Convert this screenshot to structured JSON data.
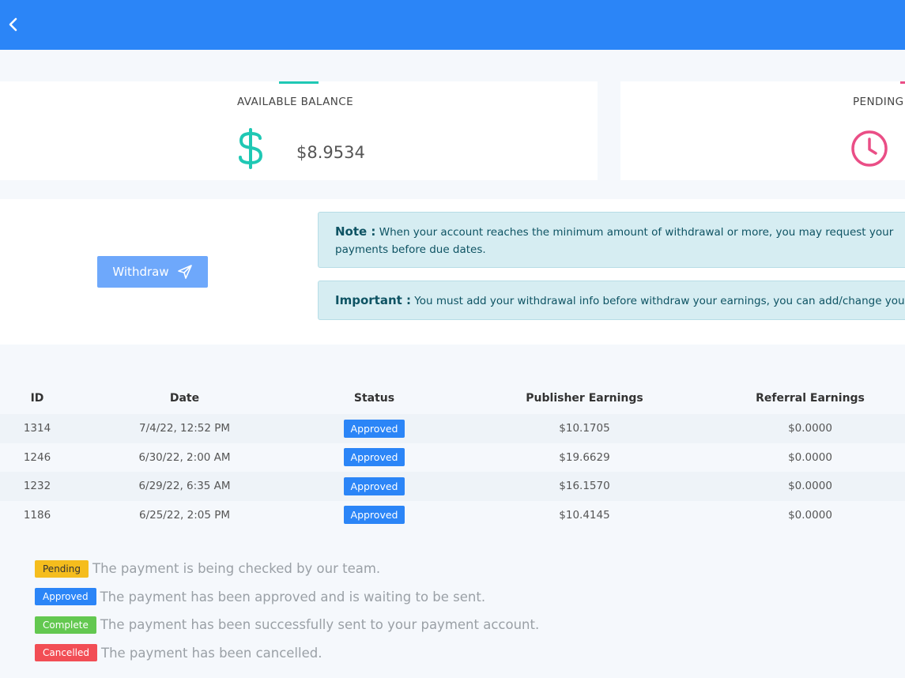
{
  "header": {
    "back_icon": "chevron-left-icon",
    "color": "#2b85f7"
  },
  "cards": {
    "available": {
      "title": "AVAILABLE BALANCE",
      "value": "$8.9534",
      "icon": "dollar-icon",
      "accent": "#1fc8b4"
    },
    "pending": {
      "title": "PENDING",
      "icon": "clock-icon",
      "accent": "#ea4e86"
    }
  },
  "withdraw": {
    "label": "Withdraw",
    "icon": "send-icon"
  },
  "notes": {
    "note": {
      "label": "Note :",
      "text": " When your account reaches the minimum amount of withdrawal or more, you may request your",
      "text2": "payments before due dates."
    },
    "important": {
      "label": "Important :",
      "text": " You must add your withdrawal info before withdraw your earnings, you can add/change your"
    }
  },
  "table": {
    "headers": {
      "id": "ID",
      "date": "Date",
      "status": "Status",
      "publisher": "Publisher Earnings",
      "referral": "Referral Earnings"
    },
    "rows": [
      {
        "id": "1314",
        "date": "7/4/22, 12:52 PM",
        "status": "Approved",
        "publisher": "$10.1705",
        "referral": "$0.0000"
      },
      {
        "id": "1246",
        "date": "6/30/22, 2:00 AM",
        "status": "Approved",
        "publisher": "$19.6629",
        "referral": "$0.0000"
      },
      {
        "id": "1232",
        "date": "6/29/22, 6:35 AM",
        "status": "Approved",
        "publisher": "$16.1570",
        "referral": "$0.0000"
      },
      {
        "id": "1186",
        "date": "6/25/22, 2:05 PM",
        "status": "Approved",
        "publisher": "$10.4145",
        "referral": "$0.0000"
      }
    ]
  },
  "legend": [
    {
      "badge": "Pending",
      "text": "The payment is being checked by our team.",
      "color": "#f5bd1d"
    },
    {
      "badge": "Approved",
      "text": "The payment has been approved and is waiting to be sent.",
      "color": "#2b85f7"
    },
    {
      "badge": "Complete",
      "text": "The payment has been successfully sent to your payment account.",
      "color": "#63c850"
    },
    {
      "badge": "Cancelled",
      "text": "The payment has been cancelled.",
      "color": "#f24e55"
    }
  ]
}
